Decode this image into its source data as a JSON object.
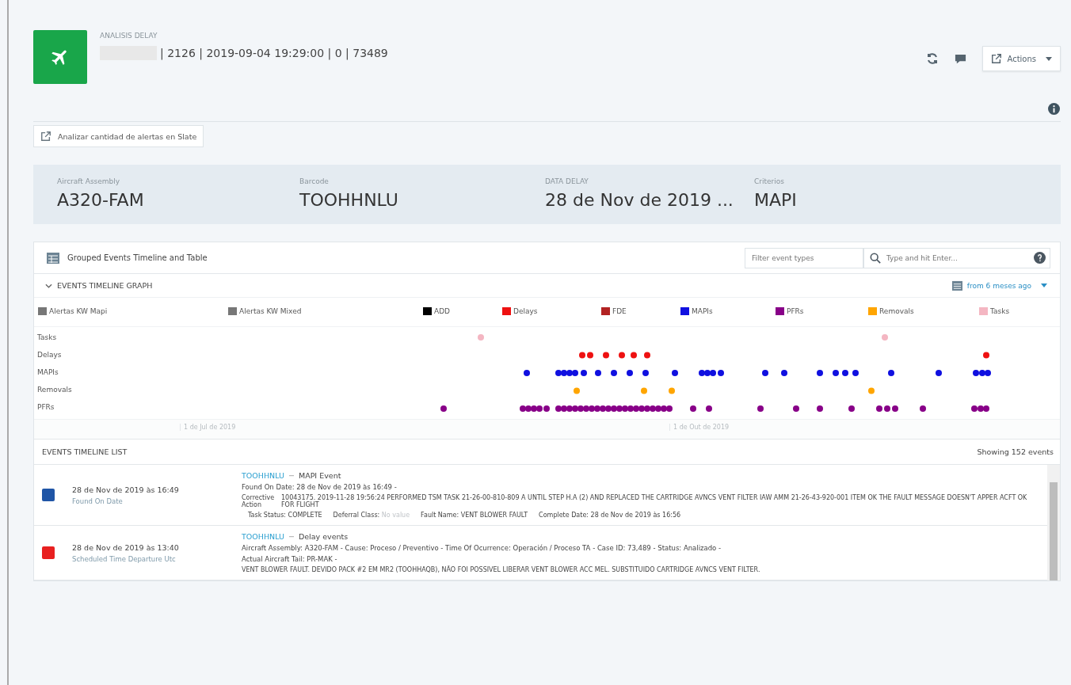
{
  "header": {
    "subtitle": "ANALISIS DELAY",
    "title": "| 2126 | 2019-09-04 19:29:00 | 0 | 73489",
    "actions_button": "Actions"
  },
  "slate_button": "Analizar cantidad de alertas en Slate",
  "summary": [
    {
      "label": "Aircraft Assembly",
      "value": "A320-FAM"
    },
    {
      "label": "Barcode",
      "value": "TOOHHNLU"
    },
    {
      "label": "DATA DELAY",
      "value": "28 de Nov de 2019 ..."
    },
    {
      "label": "Criterios",
      "value": "MAPI"
    }
  ],
  "panel": {
    "title": "Grouped Events Timeline and Table",
    "filter": {
      "placeholder": "Filter event types"
    },
    "search": {
      "placeholder": "Type and hit Enter..."
    }
  },
  "graph": {
    "title": "EVENTS TIMELINE GRAPH",
    "expanded": true,
    "range": "from 6 meses ago",
    "legend": [
      {
        "label": "Alertas KW Mapi",
        "color": "#777777"
      },
      {
        "label": "Alertas KW Mixed",
        "color": "#777777"
      },
      {
        "label": "ADD",
        "color": "#000000"
      },
      {
        "label": "Delays",
        "color": "#ee1111"
      },
      {
        "label": "FDE",
        "color": "#b22222"
      },
      {
        "label": "MAPIs",
        "color": "#1010e0"
      },
      {
        "label": "PFRs",
        "color": "#880088"
      },
      {
        "label": "Removals",
        "color": "#ffa500"
      },
      {
        "label": "Tasks",
        "color": "#f4b6c2"
      }
    ],
    "rows": [
      {
        "label": "Tasks",
        "color": "#f4b6c2"
      },
      {
        "label": "Delays",
        "color": "#ee1111"
      },
      {
        "label": "MAPIs",
        "color": "#1010e0"
      },
      {
        "label": "Removals",
        "color": "#ffa500"
      },
      {
        "label": "PFRs",
        "color": "#880088"
      }
    ],
    "axis_labels": [
      "1 de Jul de 2019",
      "1 de Out de 2019"
    ]
  },
  "list": {
    "title": "EVENTS TIMELINE LIST",
    "count": "Showing 152 events",
    "events": [
      {
        "color": "#1f55a6",
        "date": "28 de Nov de 2019 às 16:49",
        "date_label": "Found On Date",
        "tail": "TOOHHNLU",
        "type": "MAPI Event",
        "lines": [
          "Found On Date: 28 de Nov de 2019 às 16:49 -"
        ],
        "field_label": "Corrective Action",
        "field_value": "10043175. 2019-11-28 19:56:24 PERFORMED TSM TASK 21-26-00-810-809 A UNTIL STEP H.A (2) AND REPLACED THE CARTRIDGE AVNCS VENT FILTER IAW AMM 21-26-43-920-001 ITEM OK THE FAULT MESSAGE DOESN'T APPER ACFT OK FOR FLIGHT",
        "footer": [
          {
            "label": "Task Status:",
            "value": "COMPLETE",
            "muted": false
          },
          {
            "label": "Deferral Class:",
            "value": "No value",
            "muted": true
          },
          {
            "label": "Fault Name:",
            "value": "VENT BLOWER FAULT",
            "muted": false
          },
          {
            "label": "Complete Date:",
            "value": "28 de Nov de 2019 às 16:56",
            "muted": false
          }
        ]
      },
      {
        "color": "#e82020",
        "date": "28 de Nov de 2019 às 13:40",
        "date_label": "Scheduled Time Departure Utc",
        "tail": "TOOHHNLU",
        "type": "Delay events",
        "lines": [
          "Aircraft Assembly: A320-FAM  -  Cause: Proceso / Preventivo  -  Time Of Ocurrence: Operación / Proceso TA  -  Case ID: 73,489  -  Status: Analizado  -",
          "Actual Aircraft Tail: PR-MAK  -"
        ],
        "field_value": "VENT BLOWER FAULT. DEVIDO PACK #2 EM MR2 (TOOHHAQB), NÃO FOI POSSIVEL LIBERAR VENT BLOWER ACC MEL. SUBSTITUIDO CARTRIDGE AVNCS VENT FILTER."
      }
    ]
  }
}
